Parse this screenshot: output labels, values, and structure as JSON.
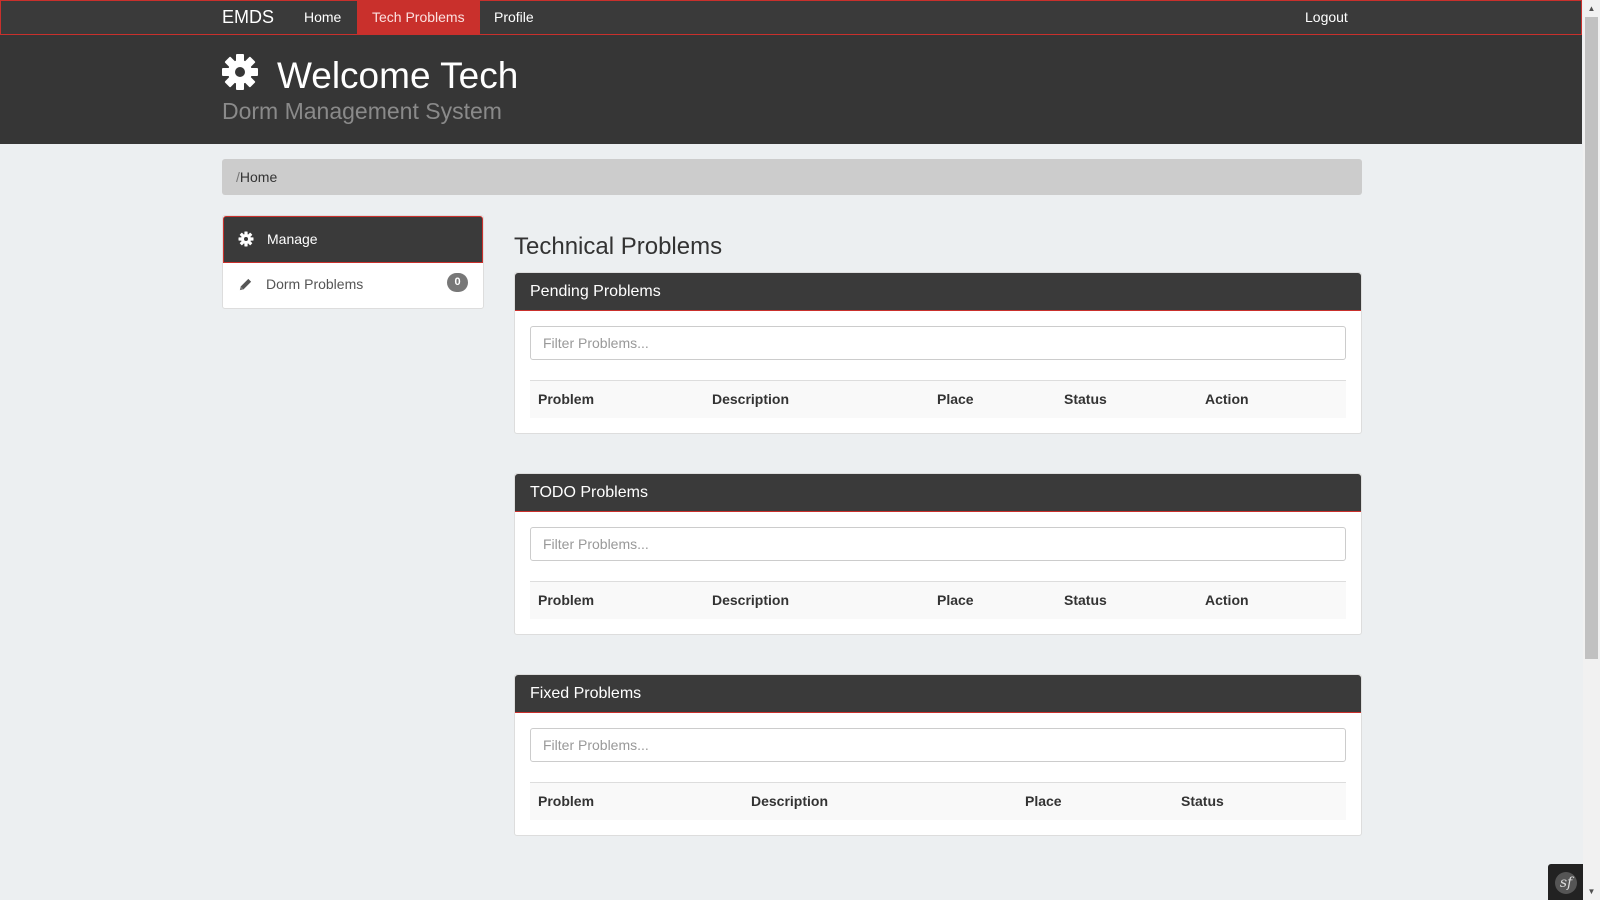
{
  "navbar": {
    "brand": "EMDS",
    "items": [
      {
        "label": "Home"
      },
      {
        "label": "Tech Problems"
      },
      {
        "label": "Profile"
      }
    ],
    "logout": "Logout"
  },
  "header": {
    "icon": "gear-icon",
    "title": "Welcome Tech",
    "subtitle": "Dorm Management System"
  },
  "breadcrumb": {
    "separator": "/",
    "current": "Home"
  },
  "sidebar": {
    "heading": {
      "label": "Manage",
      "icon": "gear-icon"
    },
    "items": [
      {
        "label": "Dorm Problems",
        "icon": "pencil-icon",
        "badge": "0"
      }
    ]
  },
  "main": {
    "title": "Technical Problems",
    "panels": [
      {
        "title": "Pending Problems",
        "filter_placeholder": "Filter Problems...",
        "columns": [
          "Problem",
          "Description",
          "Place",
          "Status",
          "Action"
        ]
      },
      {
        "title": "TODO Problems",
        "filter_placeholder": "Filter Problems...",
        "columns": [
          "Problem",
          "Description",
          "Place",
          "Status",
          "Action"
        ]
      },
      {
        "title": "Fixed Problems",
        "filter_placeholder": "Filter Problems...",
        "columns": [
          "Problem",
          "Description",
          "Place",
          "Status"
        ]
      }
    ]
  },
  "colors": {
    "accent": "#c9302c",
    "dark": "#363636",
    "background": "#eceff1"
  }
}
